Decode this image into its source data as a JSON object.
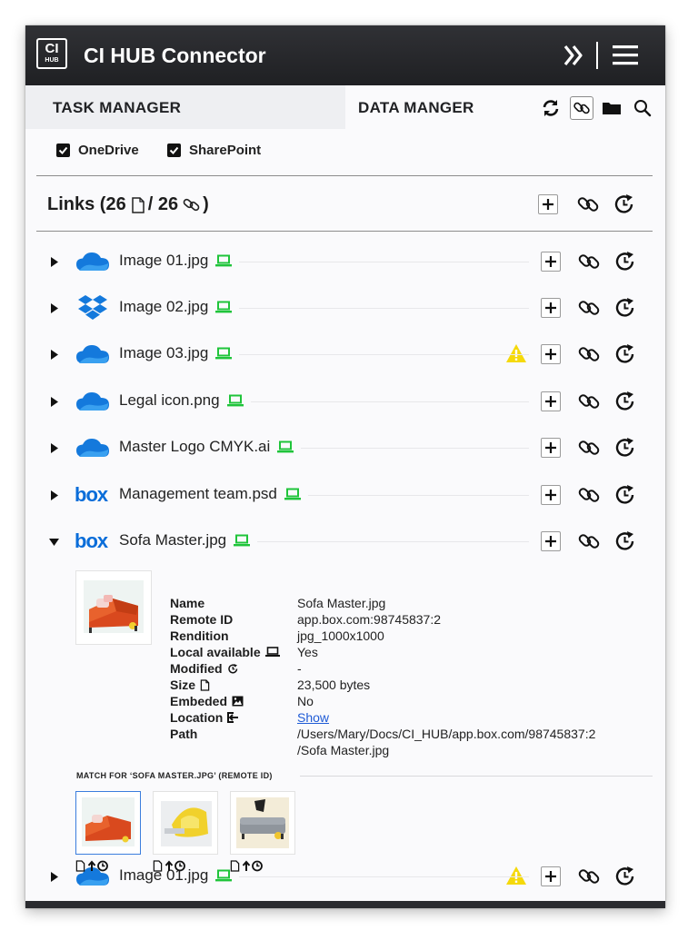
{
  "app": {
    "logo_top": "CI",
    "logo_bottom": "HUB",
    "title": "CI HUB Connector"
  },
  "tabs": {
    "task_manager": "TASK MANAGER",
    "data_manager": "DATA MANGER"
  },
  "filters": [
    {
      "label": "OneDrive",
      "checked": true
    },
    {
      "label": "SharePoint",
      "checked": true
    }
  ],
  "links": {
    "title_prefix": "Links (26",
    "separator": " / 26",
    "suffix": ")"
  },
  "rows": [
    {
      "name": "Image 01.jpg",
      "service": "onedrive",
      "warning": false
    },
    {
      "name": "Image 02.jpg",
      "service": "dropbox",
      "warning": false
    },
    {
      "name": "Image 03.jpg",
      "service": "onedrive",
      "warning": true
    },
    {
      "name": "Legal icon.png",
      "service": "onedrive",
      "warning": false
    },
    {
      "name": "Master Logo CMYK.ai",
      "service": "onedrive",
      "warning": false
    },
    {
      "name": "Management team.psd",
      "service": "box",
      "warning": false
    },
    {
      "name": "Sofa Master.jpg",
      "service": "box",
      "warning": false,
      "expanded": true
    },
    {
      "name": "Image 01.jpg",
      "service": "onedrive",
      "warning": true
    }
  ],
  "details": {
    "name_label": "Name",
    "name": "Sofa Master.jpg",
    "remote_id_label": "Remote ID",
    "remote_id": "app.box.com:98745837:2",
    "rendition_label": "Rendition",
    "rendition": "jpg_1000x1000",
    "local_label": "Local available",
    "local": "Yes",
    "modified_label": "Modified",
    "modified": "-",
    "size_label": "Size",
    "size": "23,500 bytes",
    "embeded_label": "Embeded",
    "embeded": "No",
    "location_label": "Location",
    "location": "Show",
    "path_label": "Path",
    "path_line1": "/Users/Mary/Docs/CI_HUB/app.box.com/98745837:2",
    "path_line2": "/Sofa Master.jpg"
  },
  "match": {
    "title": "MATCH FOR ‘SOFA MASTER.JPG’ (REMOTE ID)",
    "count": 3
  },
  "colors": {
    "header": "#26272a",
    "accent_green": "#1fc43a",
    "warning": "#f5d90a",
    "onedrive": "#1479dc",
    "box": "#0a6dd9",
    "link": "#1f5bd6"
  }
}
